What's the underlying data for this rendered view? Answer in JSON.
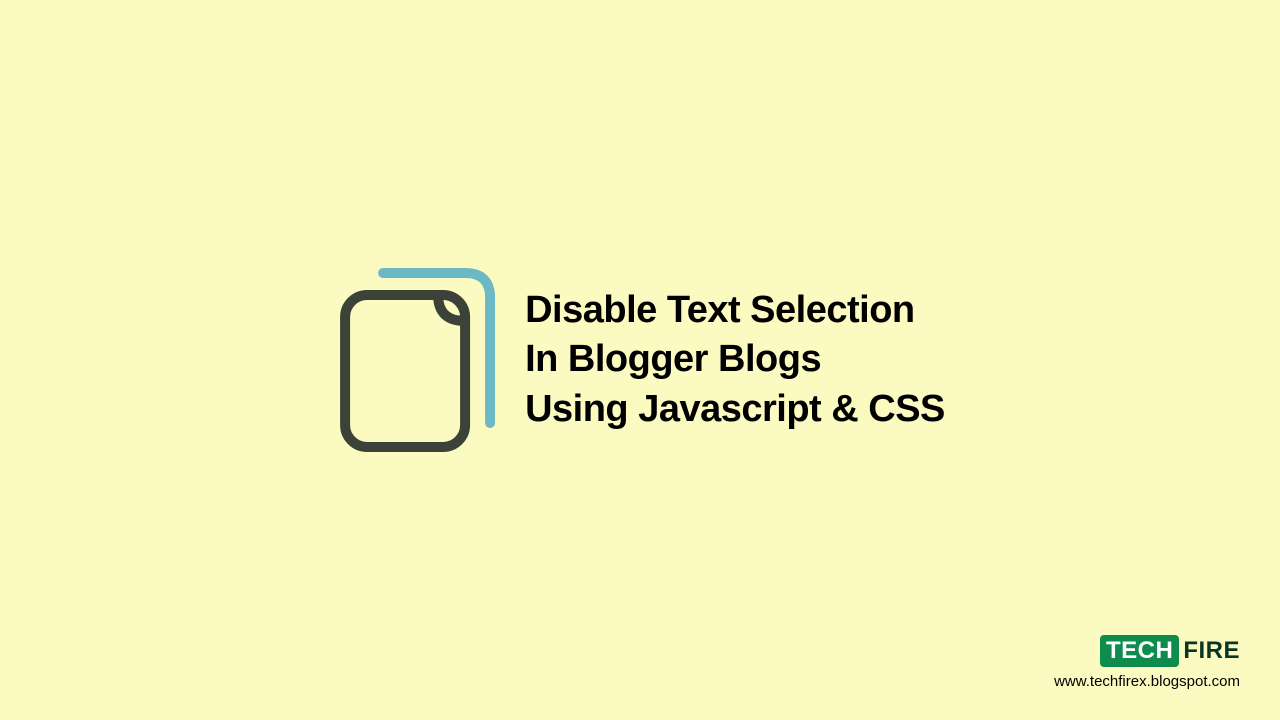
{
  "headline": {
    "line1": "Disable Text Selection",
    "line2": "In Blogger Blogs",
    "line3": "Using Javascript & CSS"
  },
  "brand": {
    "tech": "TECH",
    "fire": "FIRE",
    "url": "www.techfirex.blogspot.com"
  },
  "colors": {
    "background": "#fbfac1",
    "icon_back": "#6cb8c4",
    "icon_front": "#3d4239",
    "brand_green": "#0d8c4e",
    "brand_dark": "#0a3624"
  }
}
